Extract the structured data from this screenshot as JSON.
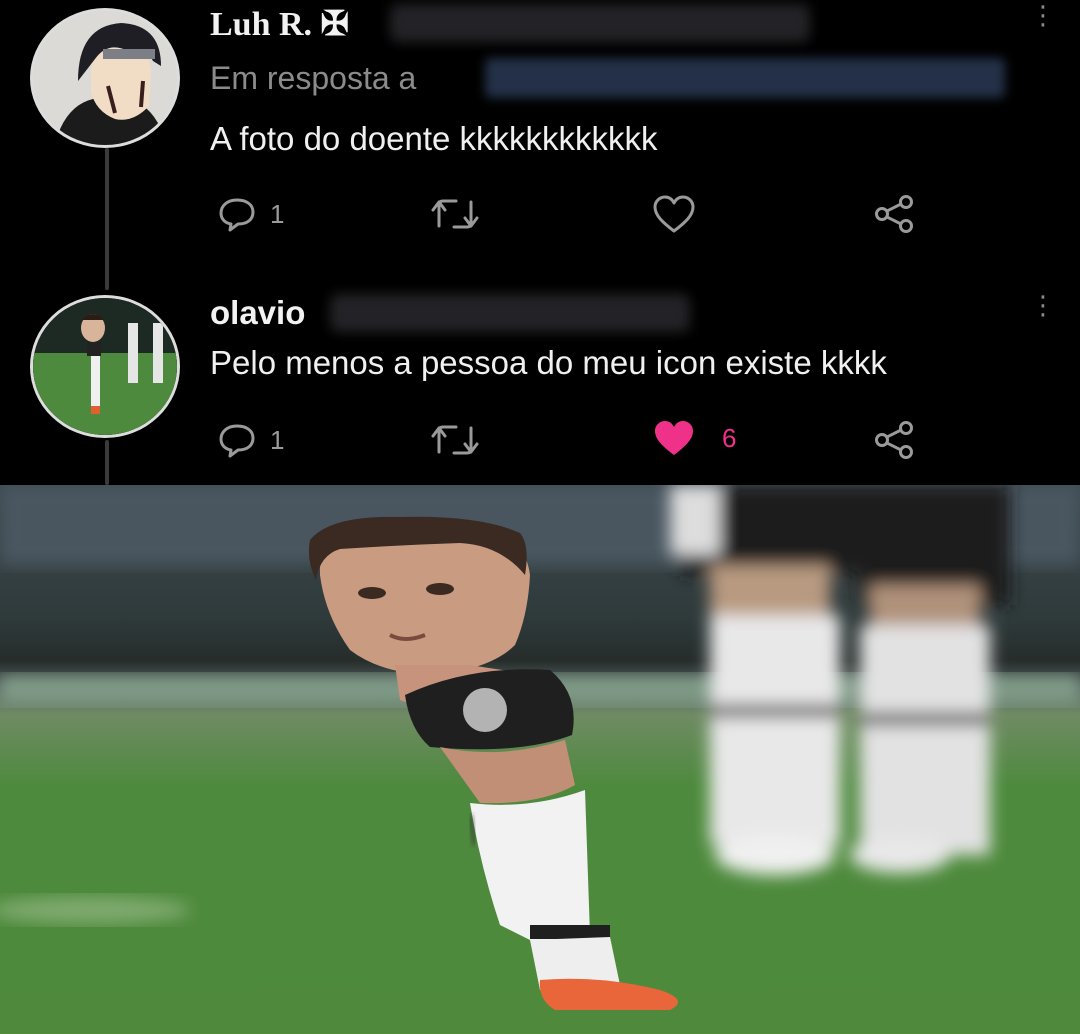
{
  "tweets": [
    {
      "display_name": "Luh R. ✠",
      "reply_label": "Em resposta a",
      "text": "A foto do doente kkkkkkkkkkkk",
      "reply_count": "1"
    },
    {
      "display_name": "olavio",
      "text": "Pelo menos a pessoa do meu icon existe kkkk",
      "reply_count": "1",
      "like_count": "6"
    }
  ],
  "colors": {
    "background": "#000000",
    "like_active": "#f0318a",
    "muted": "#8b8b8b",
    "grass": "#4f8a3c"
  },
  "icons": [
    "more-icon",
    "reply-icon",
    "retweet-icon",
    "like-icon",
    "share-icon"
  ]
}
